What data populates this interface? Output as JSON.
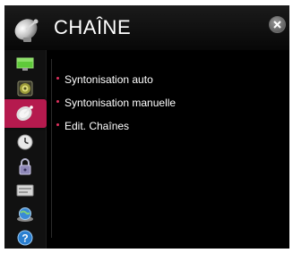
{
  "header": {
    "title": "CHAÎNE",
    "icon": "satellite-dish-icon",
    "close_icon": "close-icon"
  },
  "sidebar": {
    "items": [
      {
        "icon": "tv-picture-icon",
        "selected": false
      },
      {
        "icon": "speaker-icon",
        "selected": false
      },
      {
        "icon": "satellite-dish-icon",
        "selected": true
      },
      {
        "icon": "clock-icon",
        "selected": false
      },
      {
        "icon": "lock-icon",
        "selected": false
      },
      {
        "icon": "options-icon",
        "selected": false
      },
      {
        "icon": "network-globe-icon",
        "selected": false
      },
      {
        "icon": "help-icon",
        "selected": false
      }
    ]
  },
  "menu": {
    "items": [
      {
        "label": "Syntonisation auto"
      },
      {
        "label": "Syntonisation manuelle"
      },
      {
        "label": "Edit. Chaînes"
      }
    ]
  },
  "colors": {
    "accent": "#b51a4e",
    "bullet": "#e0315f",
    "background": "#000000",
    "text": "#ffffff"
  }
}
